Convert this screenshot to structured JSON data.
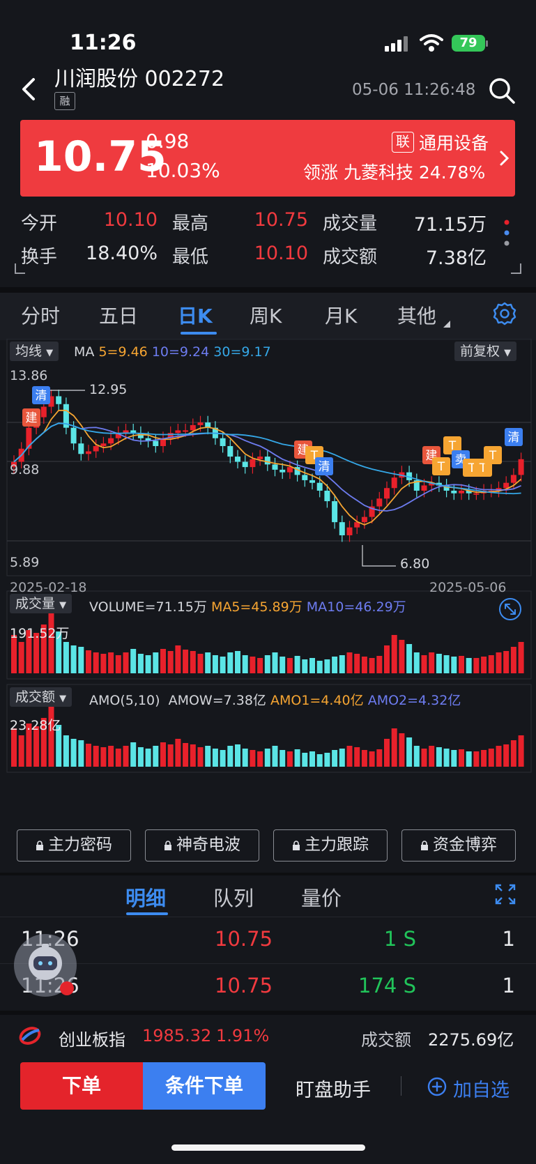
{
  "status": {
    "time": "11:26",
    "battery": "79"
  },
  "header": {
    "title": "川润股份 002272",
    "badge": "融",
    "datetime": "05-06 11:26:48"
  },
  "banner": {
    "price": "10.75",
    "change": "0.98",
    "change_pct": "10.03%",
    "sector_badge": "联",
    "sector": "通用设备",
    "leader": "领涨 九菱科技 24.78%"
  },
  "quote": {
    "open_label": "今开",
    "open": "10.10",
    "high_label": "最高",
    "high": "10.75",
    "volume_label": "成交量",
    "volume": "71.15万",
    "turnover_label": "换手",
    "turnover": "18.40%",
    "low_label": "最低",
    "low": "10.10",
    "amount_label": "成交额",
    "amount": "7.38亿"
  },
  "tabs": [
    "分时",
    "五日",
    "日K",
    "周K",
    "月K",
    "其他"
  ],
  "kline": {
    "indicator_pill": "均线",
    "ma_label": "MA",
    "ma5": "5=9.46",
    "ma10": "10=9.24",
    "ma30": "30=9.17",
    "adjust_pill": "前复权",
    "y_high": "13.86",
    "y_mid": "9.88",
    "y_low": "5.89",
    "peak_label": "12.95",
    "trough_label": "6.80",
    "date_start": "2025-02-18",
    "date_end": "2025-05-06",
    "markers": [
      "清",
      "建",
      "建",
      "T",
      "清",
      "建",
      "T",
      "T",
      "卖",
      "T",
      "T",
      "T",
      "清"
    ],
    "colors": {
      "up": "#e8212b",
      "down": "#5be5e6",
      "ma5": "#f6a532",
      "ma10": "#6d7cf0",
      "ma30": "#35a8e8"
    }
  },
  "volume_panel": {
    "pill": "成交量",
    "main": "VOLUME=71.15万",
    "ma5": "MA5=45.89万",
    "ma10": "MA10=46.29万",
    "y_max": "191.52万"
  },
  "amount_panel": {
    "pill": "成交额",
    "main": "AMO(5,10)",
    "amow": "AMOW=7.38亿",
    "amo1": "AMO1=4.40亿",
    "amo2": "AMO2=4.32亿",
    "y_max": "23.28亿"
  },
  "functions": [
    "主力密码",
    "神奇电波",
    "主力跟踪",
    "资金博弈"
  ],
  "detail_tabs": [
    "明细",
    "队列",
    "量价"
  ],
  "trades": [
    {
      "time": "11:26",
      "price": "10.75",
      "volume": "1 S",
      "count": "1"
    },
    {
      "time": "11:26",
      "price": "10.75",
      "volume": "174 S",
      "count": "1"
    }
  ],
  "index_bar": {
    "name": "创业板指",
    "value": "1985.32",
    "pct": "1.91%",
    "amount_label": "成交额",
    "amount": "2275.69亿"
  },
  "actions": {
    "order": "下单",
    "condition_order": "条件下单",
    "assistant": "盯盘助手",
    "add_watch": "加自选"
  }
}
